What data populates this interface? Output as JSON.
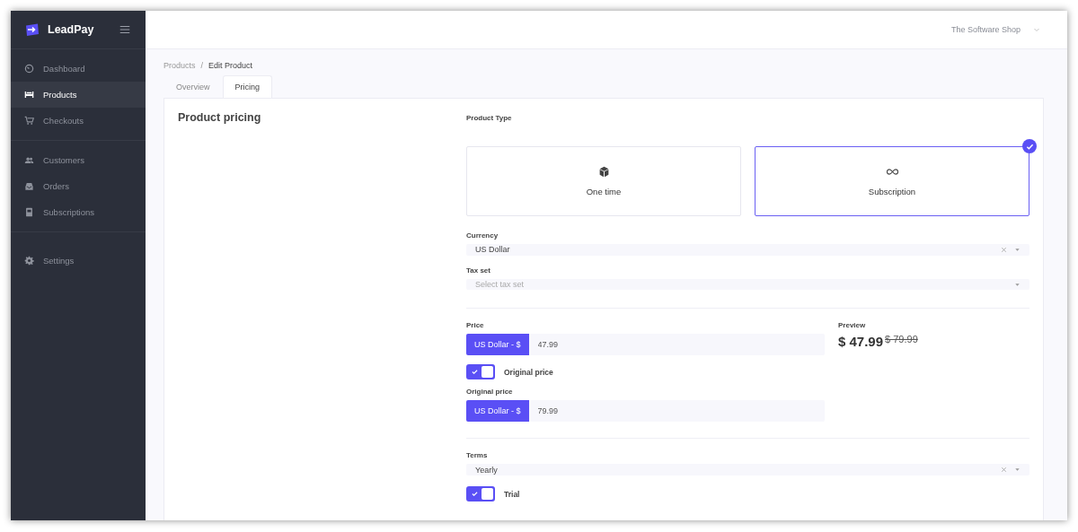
{
  "brand": {
    "name": "LeadPay"
  },
  "sidebar": {
    "groups": [
      [
        {
          "label": "Dashboard",
          "selected": false
        },
        {
          "label": "Products",
          "selected": true
        },
        {
          "label": "Checkouts",
          "selected": false
        }
      ],
      [
        {
          "label": "Customers",
          "selected": false
        },
        {
          "label": "Orders",
          "selected": false
        },
        {
          "label": "Subscriptions",
          "selected": false
        }
      ],
      [
        {
          "label": "Settings",
          "selected": false
        }
      ]
    ]
  },
  "header": {
    "account": "The Software Shop"
  },
  "breadcrumb": {
    "items": [
      "Products",
      "Edit Product"
    ],
    "separator": "/"
  },
  "tabs": [
    {
      "label": "Overview",
      "selected": false
    },
    {
      "label": "Pricing",
      "selected": true
    }
  ],
  "card": {
    "title": "Product pricing"
  },
  "product_type": {
    "label": "Product Type",
    "options": [
      {
        "label": "One time",
        "selected": false
      },
      {
        "label": "Subscription",
        "selected": true
      }
    ]
  },
  "currency": {
    "label": "Currency",
    "value": "US Dollar"
  },
  "tax_set": {
    "label": "Tax set",
    "placeholder": "Select tax set"
  },
  "price": {
    "label": "Price",
    "prefix": "US Dollar - $",
    "value": "47.99"
  },
  "original_price_toggle": {
    "label": "Original price",
    "on": true
  },
  "original_price": {
    "label": "Original price",
    "prefix": "US Dollar - $",
    "value": "79.99"
  },
  "preview": {
    "label": "Preview",
    "price": "$ 47.99",
    "original": "$ 79.99"
  },
  "terms": {
    "label": "Terms",
    "value": "Yearly"
  },
  "trial_toggle": {
    "label": "Trial",
    "on": true
  }
}
